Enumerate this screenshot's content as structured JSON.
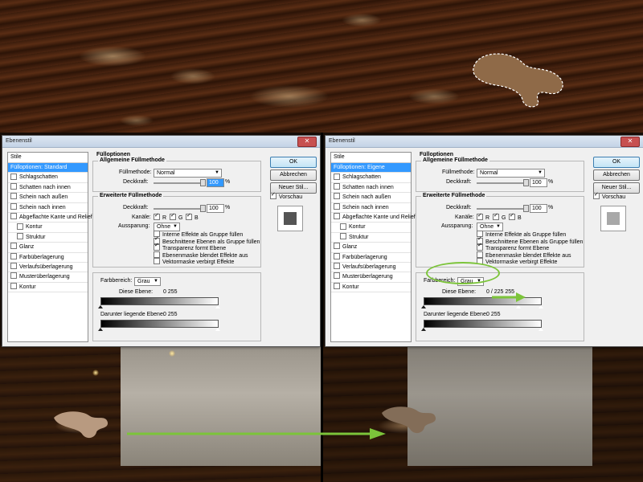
{
  "dialog_title": "Ebenenstil",
  "styles_header": "Stile",
  "left": {
    "styles": [
      {
        "label": "Fülloptionen: Standard",
        "selected": true,
        "checkbox": false
      },
      {
        "label": "Schlagschatten",
        "checkbox": true
      },
      {
        "label": "Schatten nach innen",
        "checkbox": true
      },
      {
        "label": "Schein nach außen",
        "checkbox": true
      },
      {
        "label": "Schein nach innen",
        "checkbox": true
      },
      {
        "label": "Abgeflachte Kante und Relief",
        "checkbox": true
      },
      {
        "label": "Kontur",
        "checkbox": true,
        "sub": true
      },
      {
        "label": "Struktur",
        "checkbox": true,
        "sub": true
      },
      {
        "label": "Glanz",
        "checkbox": true
      },
      {
        "label": "Farbüberlagerung",
        "checkbox": true
      },
      {
        "label": "Verlaufsüberlagerung",
        "checkbox": true
      },
      {
        "label": "Musterüberlagerung",
        "checkbox": true
      },
      {
        "label": "Kontur",
        "checkbox": true
      }
    ],
    "blend_if": {
      "this_layer_values": "0        255",
      "below_values": "0        255"
    },
    "preview_color": "#555555"
  },
  "right": {
    "styles": [
      {
        "label": "Fülloptionen: Eigene",
        "selected": true,
        "checkbox": false
      },
      {
        "label": "Schlagschatten",
        "checkbox": true
      },
      {
        "label": "Schatten nach innen",
        "checkbox": true
      },
      {
        "label": "Schein nach außen",
        "checkbox": true
      },
      {
        "label": "Schein nach innen",
        "checkbox": true
      },
      {
        "label": "Abgeflachte Kante und Relief",
        "checkbox": true
      },
      {
        "label": "Kontur",
        "checkbox": true,
        "sub": true
      },
      {
        "label": "Struktur",
        "checkbox": true,
        "sub": true
      },
      {
        "label": "Glanz",
        "checkbox": true
      },
      {
        "label": "Farbüberlagerung",
        "checkbox": true
      },
      {
        "label": "Verlaufsüberlagerung",
        "checkbox": true
      },
      {
        "label": "Musterüberlagerung",
        "checkbox": true
      },
      {
        "label": "Kontur",
        "checkbox": true
      }
    ],
    "blend_if": {
      "this_layer_values": "0   /   225       255",
      "below_values": "0        255"
    },
    "preview_color": "#a8a8a8"
  },
  "fill_options": {
    "title": "Fülloptionen",
    "general_group": "Allgemeine Füllmethode",
    "blend_mode_label": "Füllmethode:",
    "blend_mode_value": "Normal",
    "opacity_label": "Deckkraft:",
    "opacity_value": "100",
    "percent": "%",
    "advanced_group": "Erweiterte Füllmethode",
    "fill_opacity_label": "Deckkraft:",
    "fill_opacity_value": "100",
    "channels_label": "Kanäle:",
    "channel_r": "R",
    "channel_g": "G",
    "channel_b": "B",
    "knockout_label": "Aussparung:",
    "knockout_value": "Ohne",
    "options": [
      {
        "label": "Interne Effekte als Gruppe füllen",
        "checked": false
      },
      {
        "label": "Beschnittene Ebenen als Gruppe füllen",
        "checked": true
      },
      {
        "label": "Transparenz formt Ebene",
        "checked": true
      },
      {
        "label": "Ebenenmaske blendet Effekte aus",
        "checked": false
      },
      {
        "label": "Vektormaske verbirgt Effekte",
        "checked": false
      }
    ],
    "blend_if_label": "Farbbereich:",
    "blend_if_value": "Grau",
    "this_layer_label": "Diese Ebene:",
    "below_layer_label": "Darunter liegende Ebene:"
  },
  "buttons": {
    "ok": "OK",
    "cancel": "Abbrechen",
    "new_style": "Neuer Stil...",
    "preview": "Vorschau"
  },
  "colors": {
    "arrow": "#7cc43a",
    "selection": "#3399ff"
  }
}
